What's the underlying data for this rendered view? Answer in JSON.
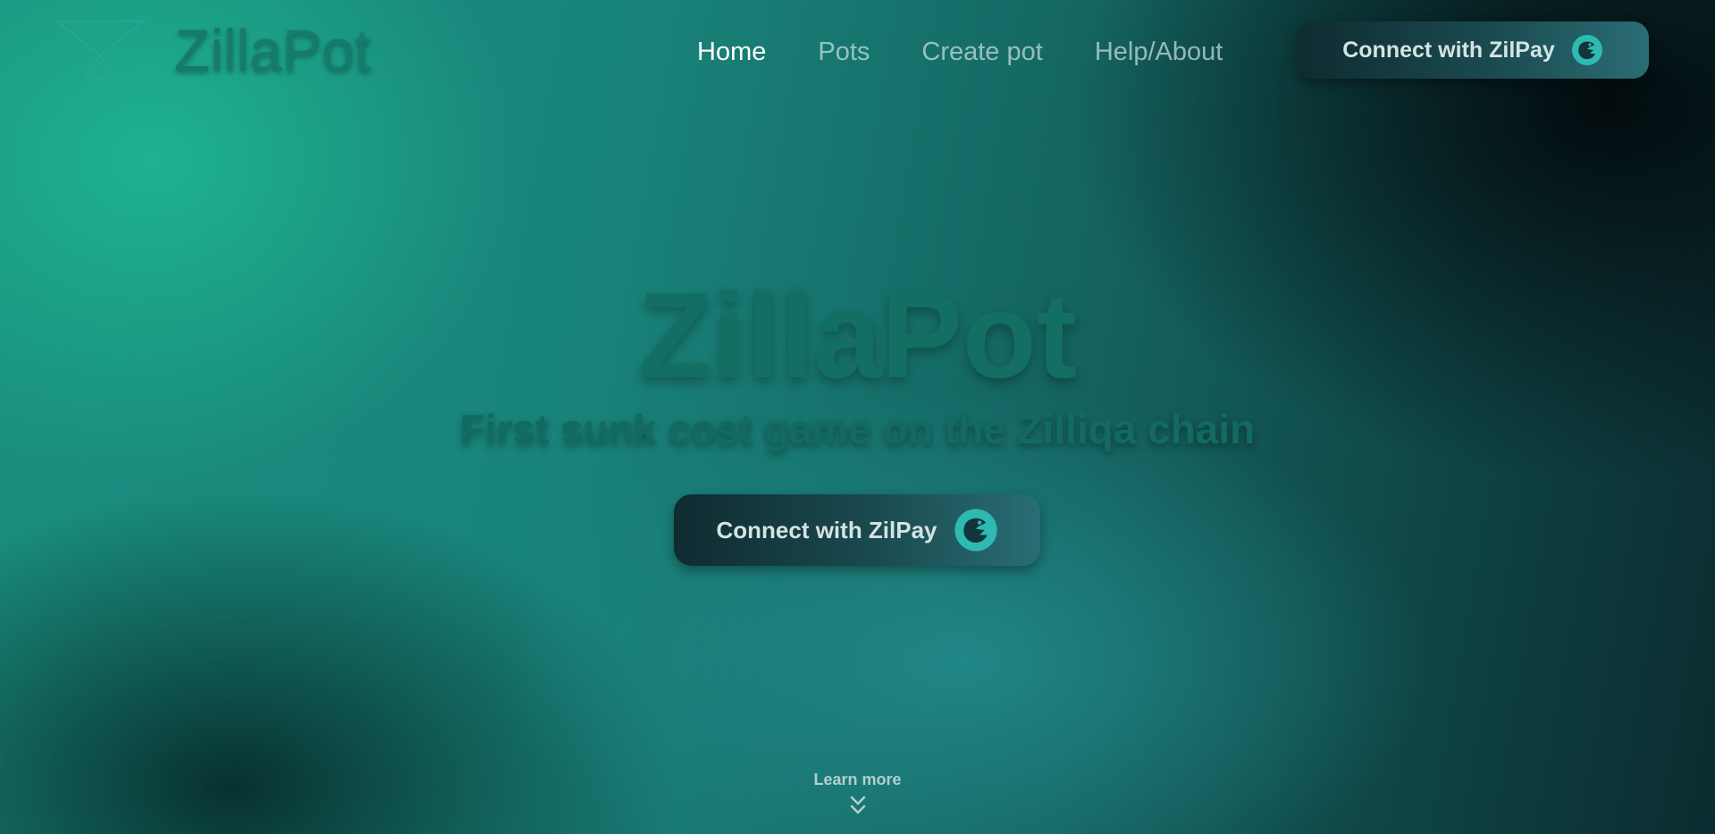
{
  "nav": {
    "brand": "ZillaPot",
    "logo_icon": "hourglass-icon",
    "items": [
      {
        "label": "Home",
        "active": true
      },
      {
        "label": "Pots",
        "active": false
      },
      {
        "label": "Create pot",
        "active": false
      },
      {
        "label": "Help/About",
        "active": false
      }
    ],
    "connect_label": "Connect with ZilPay",
    "connect_icon": "zilpay-icon"
  },
  "hero": {
    "title": "ZillaPot",
    "subtitle": "First sunk cost game on the Zilliqa chain",
    "connect_label": "Connect with ZilPay",
    "connect_icon": "zilpay-icon"
  },
  "footer": {
    "learn_more": "Learn more",
    "learn_icon": "double-chevron-down-icon"
  },
  "colors": {
    "accent": "#2fbab1",
    "brand_text": "#167b6c",
    "nav_active": "#ffffff"
  }
}
